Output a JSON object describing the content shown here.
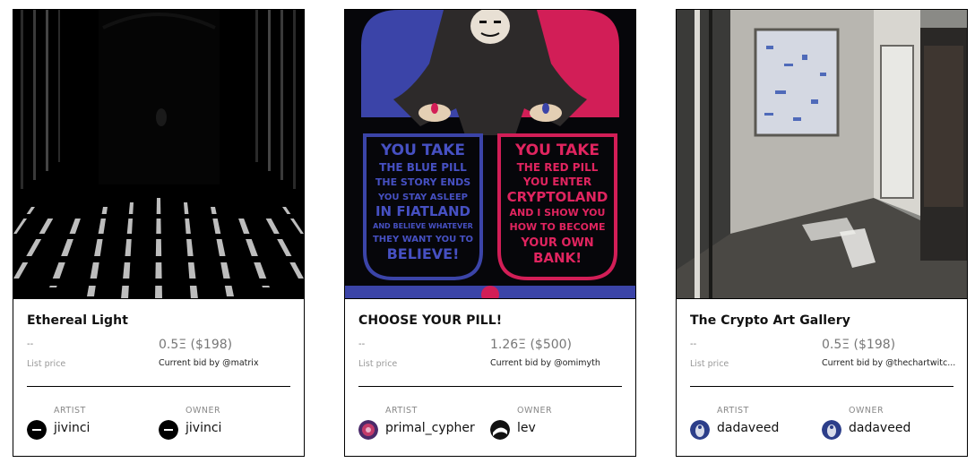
{
  "cards": [
    {
      "title": "Ethereal Light",
      "dash": "--",
      "list_label": "List price",
      "price": "0.5Ξ ($198)",
      "bid": "Current bid by @matrix",
      "artist_label": "ARTIST",
      "artist": "jivinci",
      "owner_label": "OWNER",
      "owner": "jivinci"
    },
    {
      "title": "CHOOSE YOUR PILL!",
      "dash": "--",
      "list_label": "List price",
      "price": "1.26Ξ ($500)",
      "bid": "Current bid by @omimyth",
      "artist_label": "ARTIST",
      "artist": "primal_cypher",
      "owner_label": "OWNER",
      "owner": "lev",
      "art_text": {
        "left": [
          "YOU TAKE",
          "THE BLUE PILL",
          "THE STORY ENDS",
          "YOU STAY ASLEEP",
          "IN FIATLAND",
          "AND BELIEVE WHATEVER",
          "THEY WANT YOU TO",
          "BELIEVE!"
        ],
        "right": [
          "YOU TAKE",
          "THE RED PILL",
          "YOU ENTER",
          "CRYPTOLAND",
          "AND I SHOW YOU",
          "HOW TO BECOME",
          "YOUR OWN",
          "BANK!"
        ]
      }
    },
    {
      "title": "The Crypto Art Gallery",
      "dash": "--",
      "list_label": "List price",
      "price": "0.5Ξ ($198)",
      "bid": "Current bid by @thechartwitc...",
      "artist_label": "ARTIST",
      "artist": "dadaveed",
      "owner_label": "OWNER",
      "owner": "dadaveed"
    }
  ],
  "colors": {
    "blue": "#3b44a8",
    "red": "#d21e57",
    "border": "#000000"
  }
}
